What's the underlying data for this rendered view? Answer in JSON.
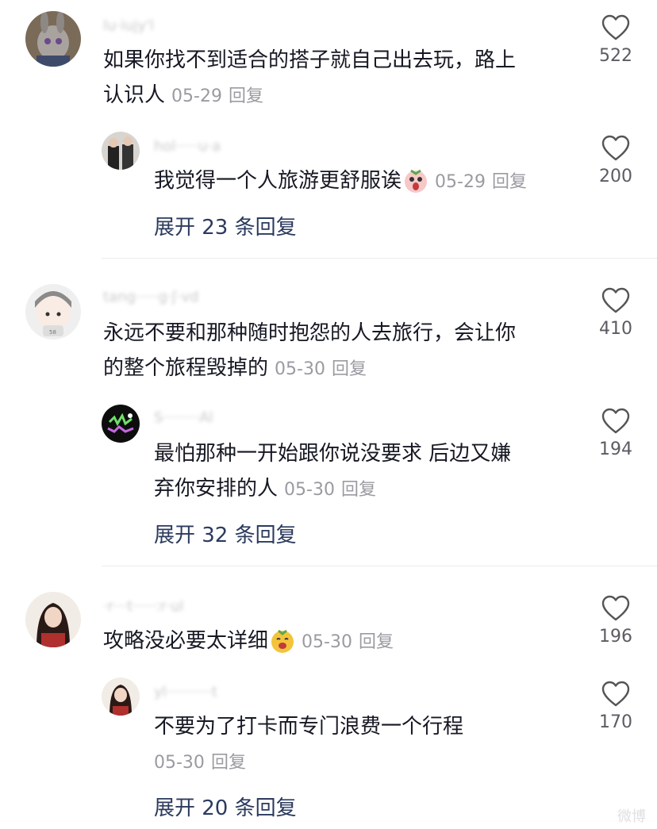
{
  "comments": [
    {
      "username": "lu·iujy'l",
      "text": "如果你找不到适合的搭子就自己出去玩，路上认识人",
      "text_line1": "如果你找不到适合的搭子就自己出去玩，路上",
      "text_line2": "认识人",
      "date": "05-29",
      "reply_label": "回复",
      "likes": "522",
      "reply": {
        "username": "hol·····u·a",
        "text": "我觉得一个人旅游更舒服诶",
        "date": "05-29",
        "reply_label": "回复",
        "likes": "200",
        "expand": "展开 23 条回复"
      }
    },
    {
      "username": "tang·····g·ʃ·vd",
      "text_line1": "永远不要和那种随时抱怨的人去旅行，会让你",
      "text_line2": "的整个旅程毁掉的",
      "date": "05-30",
      "reply_label": "回复",
      "likes": "410",
      "reply": {
        "username": "S········Al",
        "text_line1": "最怕那种一开始跟你说没要求  后边又嫌",
        "text_line2": "弃你安排的人",
        "date": "05-30",
        "reply_label": "回复",
        "likes": "194",
        "expand": "展开 32 条回复"
      }
    },
    {
      "username": "·r···t·····:r·ul",
      "text": "攻略没必要太详细",
      "date": "05-30",
      "reply_label": "回复",
      "likes": "196",
      "reply": {
        "username": "yl··········t",
        "text": "不要为了打卡而专门浪费一个行程",
        "date": "05-30",
        "reply_label": "回复",
        "likes": "170",
        "expand": "展开 20 条回复"
      }
    }
  ],
  "watermark": "微博",
  "colors": {
    "text": "#161823",
    "meta": "#9a9ba1",
    "expand": "#2b3a5e",
    "divider": "#ececec"
  }
}
